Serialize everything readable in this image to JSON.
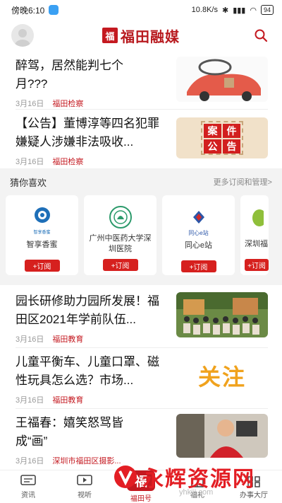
{
  "status_bar": {
    "time": "傍晚6:10",
    "net_speed": "10.8K/s",
    "battery": "94"
  },
  "header": {
    "brand_mark": "福",
    "brand_name": "福田融媒"
  },
  "news_top": [
    {
      "title": "醉驾，居然能判七个月???",
      "date": "3月16日",
      "source": "福田检察"
    },
    {
      "title": "【公告】董博淳等四名犯罪嫌疑人涉嫌非法吸收...",
      "date": "3月16日",
      "source": "福田检察",
      "thumb_text": [
        "案",
        "件",
        "公",
        "告"
      ]
    }
  ],
  "recommend": {
    "title": "猜你喜欢",
    "more": "更多订阅和管理>",
    "subscribe_label": "+订阅",
    "cards": [
      {
        "name": "智享香蜜",
        "logo_caption": "智享香蜜"
      },
      {
        "name": "广州中医药大学深圳医院"
      },
      {
        "name": "同心e站",
        "logo_caption": "同心e站"
      },
      {
        "name": "深圳福"
      }
    ]
  },
  "news_bottom": [
    {
      "title": "园长研修助力园所发展！福田区2021年学前队伍...",
      "date": "3月16日",
      "source": "福田教育"
    },
    {
      "title": "儿童平衡车、儿童口罩、磁性玩具怎么选？市场...",
      "date": "3月16日",
      "source": "福田教育",
      "thumb_text": "关注"
    },
    {
      "title": "王福春：嬉笑怒骂皆成“画”",
      "date": "3月16日",
      "source": "深圳市福田区摄影..."
    }
  ],
  "tab_bar": {
    "tabs": [
      "资讯",
      "视听",
      "福田号",
      "福礼",
      "办事大厅"
    ],
    "center_glyph": "福"
  },
  "watermark": {
    "text": "永辉资源网",
    "url": "yhkjjj.com"
  },
  "colors": {
    "brand_red": "#c41920",
    "subscribe_red": "#d6201e",
    "background_section": "#f3f3f3"
  }
}
